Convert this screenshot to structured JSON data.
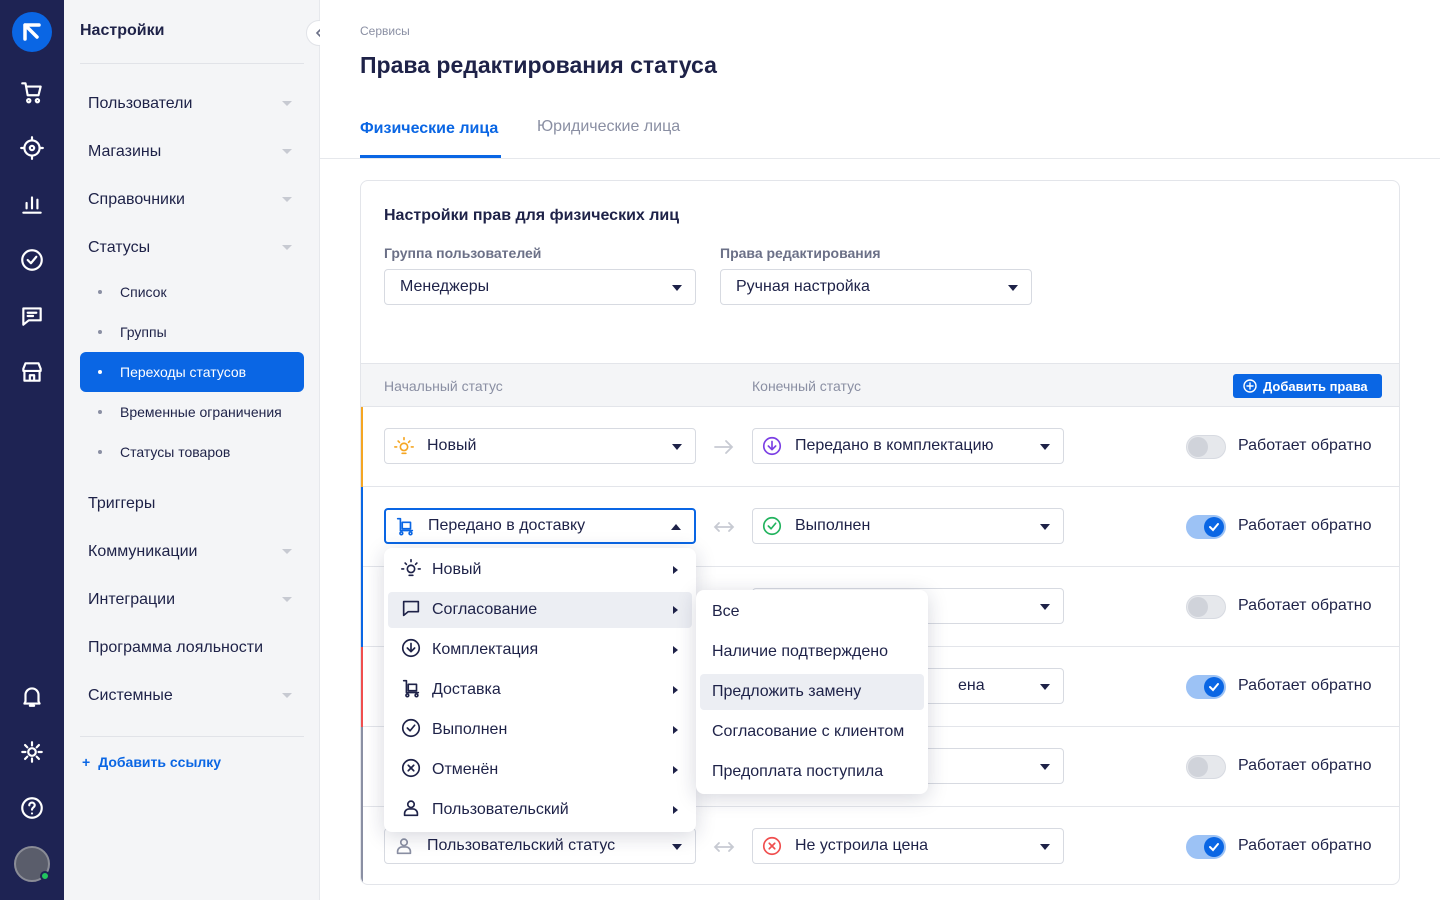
{
  "sidebar": {
    "title": "Настройки",
    "items": [
      {
        "label": "Пользователи"
      },
      {
        "label": "Магазины"
      },
      {
        "label": "Справочники"
      },
      {
        "label": "Статусы"
      },
      {
        "label": "Триггеры"
      },
      {
        "label": "Коммуникации"
      },
      {
        "label": "Интеграции"
      },
      {
        "label": "Программа лояльности"
      },
      {
        "label": "Системные"
      }
    ],
    "subitems": [
      {
        "label": "Список"
      },
      {
        "label": "Группы"
      },
      {
        "label": "Переходы статусов",
        "active": true
      },
      {
        "label": "Временные ограничения"
      },
      {
        "label": "Статусы товаров"
      }
    ],
    "add_link": "Добавить ссылку"
  },
  "page": {
    "breadcrumb": "Сервисы",
    "title": "Права редактирования статуса",
    "tabs": [
      {
        "label": "Физические лица",
        "active": true
      },
      {
        "label": "Юридические лица"
      }
    ]
  },
  "card": {
    "title": "Настройки прав для физических лиц",
    "group_label": "Группа пользователей",
    "group_value": "Менеджеры",
    "rights_label": "Права редактирования",
    "rights_value": "Ручная настройка"
  },
  "table": {
    "col_start": "Начальный статус",
    "col_end": "Конечный статус",
    "add_button": "Добавить права",
    "toggle_label": "Работает обратно",
    "rows": [
      {
        "start": "Новый",
        "end": "Передано в комплектацию",
        "reverse": false,
        "accent": "#f5a623"
      },
      {
        "start": "Передано в доставку",
        "end": "Выполнен",
        "reverse": true,
        "accent": "#0a66e4"
      },
      {
        "start": "",
        "end": "",
        "reverse": false,
        "accent": "#0a66e4"
      },
      {
        "start": "",
        "end": "ена",
        "reverse": true,
        "accent": "#f04e4e"
      },
      {
        "start": "",
        "end": "",
        "reverse": false,
        "accent": "#8a8fa3"
      },
      {
        "start": "Пользовательский статус",
        "end": "Не устроила цена",
        "reverse": true,
        "accent": "#8a8fa3"
      }
    ]
  },
  "dropdown": {
    "items": [
      {
        "label": "Новый",
        "icon": "bulb-icon"
      },
      {
        "label": "Согласование",
        "icon": "chat-icon",
        "highlighted": true
      },
      {
        "label": "Комплектация",
        "icon": "download-circle-icon"
      },
      {
        "label": "Доставка",
        "icon": "cart-dolly-icon"
      },
      {
        "label": "Выполнен",
        "icon": "check-circle-icon"
      },
      {
        "label": "Отменён",
        "icon": "x-circle-icon"
      },
      {
        "label": "Пользовательский",
        "icon": "user-icon"
      }
    ],
    "submenu": [
      {
        "label": "Все"
      },
      {
        "label": "Наличие подтверждено"
      },
      {
        "label": "Предложить замену",
        "highlighted": true
      },
      {
        "label": "Согласование с клиентом"
      },
      {
        "label": "Предоплата поступила"
      }
    ]
  },
  "colors": {
    "accent": "#0a66e4",
    "rail": "#1e2353",
    "success": "#22b35e",
    "error": "#f04e4e",
    "new": "#f5a623",
    "violet": "#7b3fe4"
  }
}
